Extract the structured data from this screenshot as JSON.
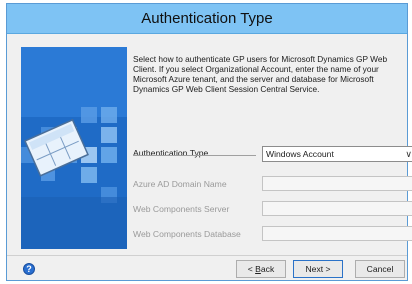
{
  "window": {
    "title": "Authentication Type"
  },
  "intro": {
    "text": "Select how to authenticate GP users for Microsoft Dynamics GP Web Client.  If you select Organizational Account, enter the name of your Microsoft Azure tenant, and the server and database for Microsoft Dynamics GP Web Client Session Central Service."
  },
  "form": {
    "auth_type_label": "Authentication Type",
    "auth_type_value": "Windows Account",
    "azure_domain_label": "Azure AD Domain Name",
    "azure_domain_value": "",
    "web_server_label": "Web Components Server",
    "web_server_value": "",
    "web_db_label": "Web Components Database",
    "web_db_value": ""
  },
  "footer": {
    "back_accel": "B",
    "back_rest": "ack",
    "back_prefix": "< ",
    "next_label": "Next >",
    "cancel_label": "Cancel"
  },
  "colors": {
    "title_bar": "#7ec3f4",
    "side_panel": "#1f6bc6"
  },
  "icons": {
    "help": "help-icon",
    "dropdown": "chevron-down-icon"
  }
}
